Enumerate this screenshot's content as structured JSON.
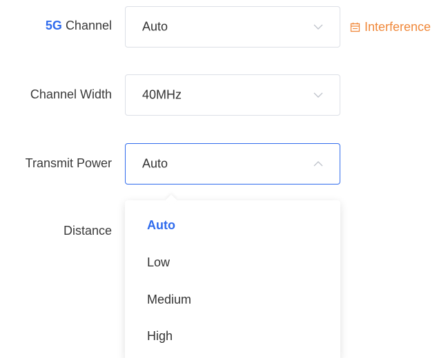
{
  "fields": {
    "channel": {
      "prefix": "5G",
      "label": "Channel",
      "value": "Auto"
    },
    "channel_width": {
      "label": "Channel Width",
      "value": "40MHz"
    },
    "transmit_power": {
      "label": "Transmit Power",
      "value": "Auto"
    },
    "distance": {
      "label": "Distance"
    }
  },
  "interference_link": {
    "label": "Interference",
    "icon": "calendar-icon"
  },
  "dropdown": {
    "options": [
      "Auto",
      "Low",
      "Medium",
      "High"
    ],
    "selected": "Auto"
  },
  "colors": {
    "accent": "#2f6bed",
    "warning": "#f0883a",
    "text": "#3a3a3a",
    "border": "#dcdfe6"
  }
}
